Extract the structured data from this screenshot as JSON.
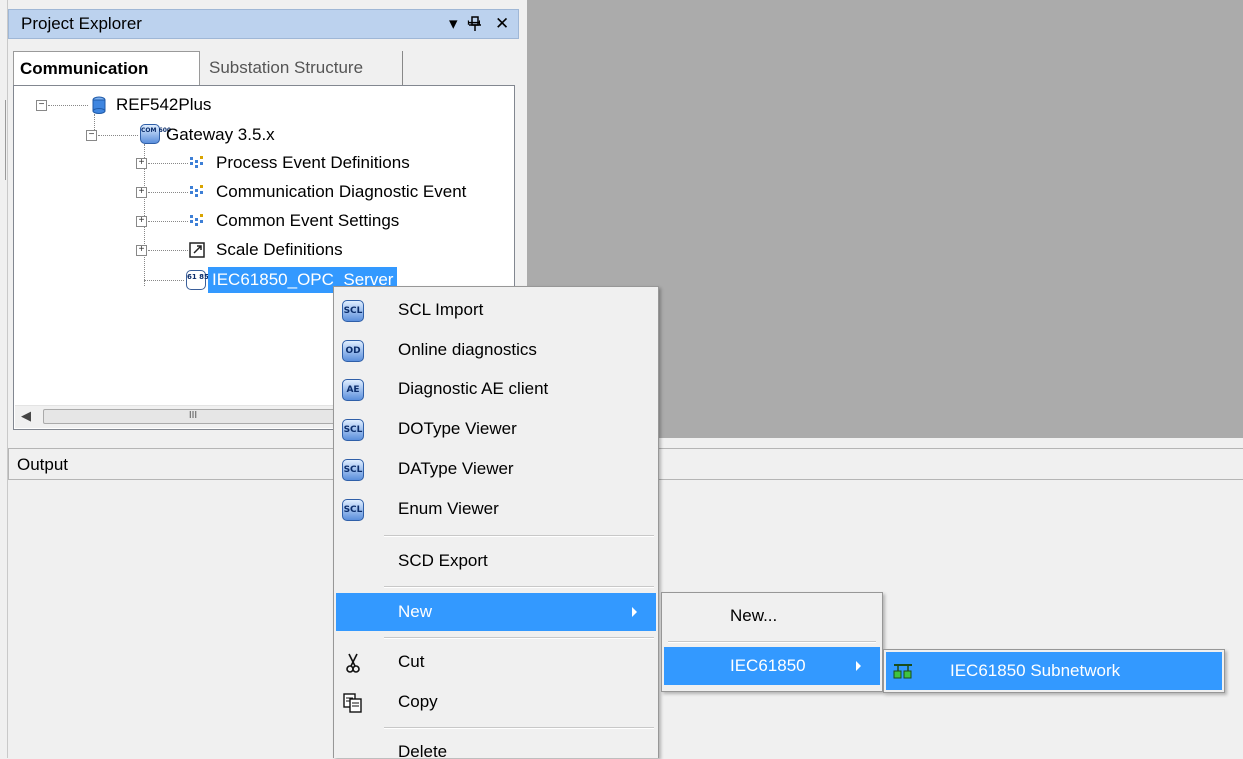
{
  "explorer": {
    "title": "Project Explorer",
    "pin_glyph": "▾ ⊥",
    "close_glyph": "✕",
    "tabs": [
      {
        "label": "Communication",
        "active": true
      },
      {
        "label": "Substation Structure",
        "active": false
      }
    ],
    "tree": [
      {
        "label": "REF542Plus",
        "icon": "database-icon",
        "expander": "−"
      },
      {
        "label": "Gateway 3.5.x",
        "icon": "com600-icon",
        "icon_text": "COM 600",
        "expander": "−"
      },
      {
        "label": "Process Event Definitions",
        "icon": "event-definitions-icon",
        "expander": "+"
      },
      {
        "label": "Communication Diagnostic Event",
        "icon": "event-definitions-icon",
        "expander": "+"
      },
      {
        "label": "Common Event Settings",
        "icon": "event-definitions-icon",
        "expander": "+"
      },
      {
        "label": "Scale Definitions",
        "icon": "scale-icon",
        "expander": "+"
      },
      {
        "label": "IEC61850_OPC_Server",
        "icon": "iec61850-icon",
        "icon_text": "61 850",
        "selected": true
      }
    ],
    "scroll_thumb_glyph": "III"
  },
  "output": {
    "title": "Output"
  },
  "context_menu": {
    "items": [
      {
        "label": "SCL Import",
        "icon": "scl-icon",
        "icon_text": "SCL"
      },
      {
        "label": "Online diagnostics",
        "icon": "od-icon",
        "icon_text": "OD"
      },
      {
        "label": "Diagnostic AE client",
        "icon": "ae-icon",
        "icon_text": "AE"
      },
      {
        "label": "DOType Viewer",
        "icon": "scl-icon",
        "icon_text": "SCL"
      },
      {
        "label": "DAType Viewer",
        "icon": "scl-icon",
        "icon_text": "SCL"
      },
      {
        "label": "Enum Viewer",
        "icon": "scl-icon",
        "icon_text": "SCL"
      },
      {
        "label": "SCD Export"
      },
      {
        "label": "New",
        "submenu": true,
        "highlighted": true
      },
      {
        "label": "Cut",
        "icon": "scissors-icon"
      },
      {
        "label": "Copy",
        "icon": "copy-icon"
      },
      {
        "label": "Delete"
      }
    ]
  },
  "new_submenu": {
    "items": [
      {
        "label": "New..."
      },
      {
        "label": "IEC61850",
        "submenu": true,
        "highlighted": true
      }
    ]
  },
  "iec_submenu": {
    "items": [
      {
        "label": "IEC61850 Subnetwork",
        "icon": "subnetwork-icon",
        "highlighted": true
      }
    ]
  },
  "colors": {
    "selection": "#3399ff",
    "document_area": "#ababab",
    "panel_header": "#bcd2ee"
  }
}
